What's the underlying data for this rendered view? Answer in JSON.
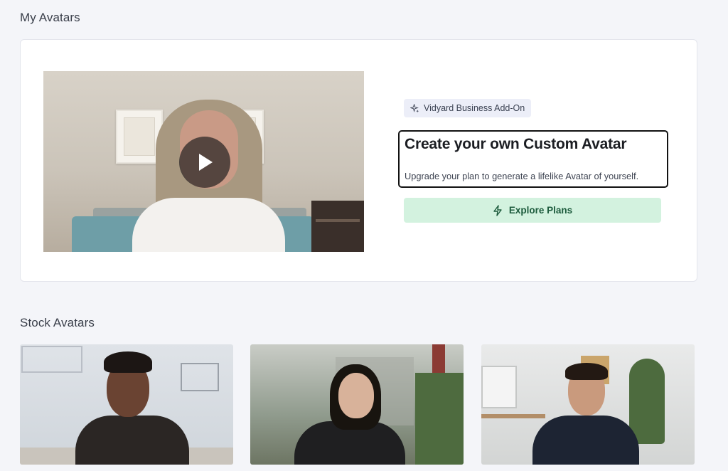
{
  "sections": {
    "my_avatars_title": "My Avatars",
    "stock_avatars_title": "Stock Avatars"
  },
  "custom_avatar_card": {
    "badge_label": "Vidyard Business Add-On",
    "badge_icon": "sparkles-icon",
    "headline": "Create your own Custom Avatar",
    "description": "Upgrade your plan to generate a lifelike Avatar of yourself.",
    "cta_label": "Explore Plans",
    "cta_icon": "lightning-icon",
    "play_icon": "play-icon"
  },
  "stock_avatars": [
    {
      "name": "stock-avatar-1"
    },
    {
      "name": "stock-avatar-2"
    },
    {
      "name": "stock-avatar-3"
    }
  ],
  "colors": {
    "background": "#f4f5f9",
    "cta_background": "#d3f2df",
    "cta_text": "#1c5b3c",
    "badge_background": "#eceef8"
  }
}
